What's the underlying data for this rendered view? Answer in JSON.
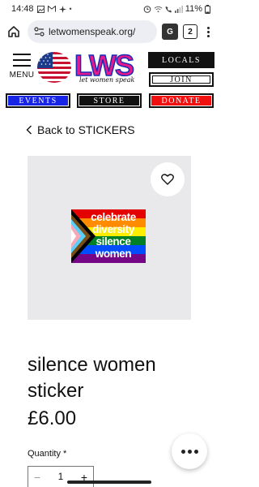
{
  "status_bar": {
    "time": "14:48",
    "battery": "11%"
  },
  "browser": {
    "url": "letwomenspeak.org/",
    "tab_count": "2"
  },
  "header": {
    "menu_label": "MENU",
    "logo_text": "LWS",
    "logo_tagline": "let women speak",
    "buttons": {
      "locals": "LOCALS",
      "join": "JOIN",
      "events": "EVENTS",
      "store": "STORE",
      "donate": "DONATE"
    },
    "colors": {
      "events": "#1726e6",
      "store": "#111111",
      "donate": "#f01010",
      "logo_pink": "#e61a8d",
      "logo_blue": "#1a2bb5"
    }
  },
  "back_link": "Back to STICKERS",
  "product": {
    "sticker_lines": [
      "celebrate",
      "diversity",
      "silence",
      "women"
    ],
    "title": "silence women sticker",
    "price": "£6.00",
    "quantity_label": "Quantity *",
    "quantity": "1"
  },
  "icons": {
    "home": "home-icon",
    "site_info": "site-info-icon",
    "translate": "translate-icon",
    "tabs": "tabs-icon",
    "more": "more-vert-icon",
    "wishlist": "heart-icon",
    "back": "chevron-left-icon",
    "chat": "more-horiz-icon"
  }
}
